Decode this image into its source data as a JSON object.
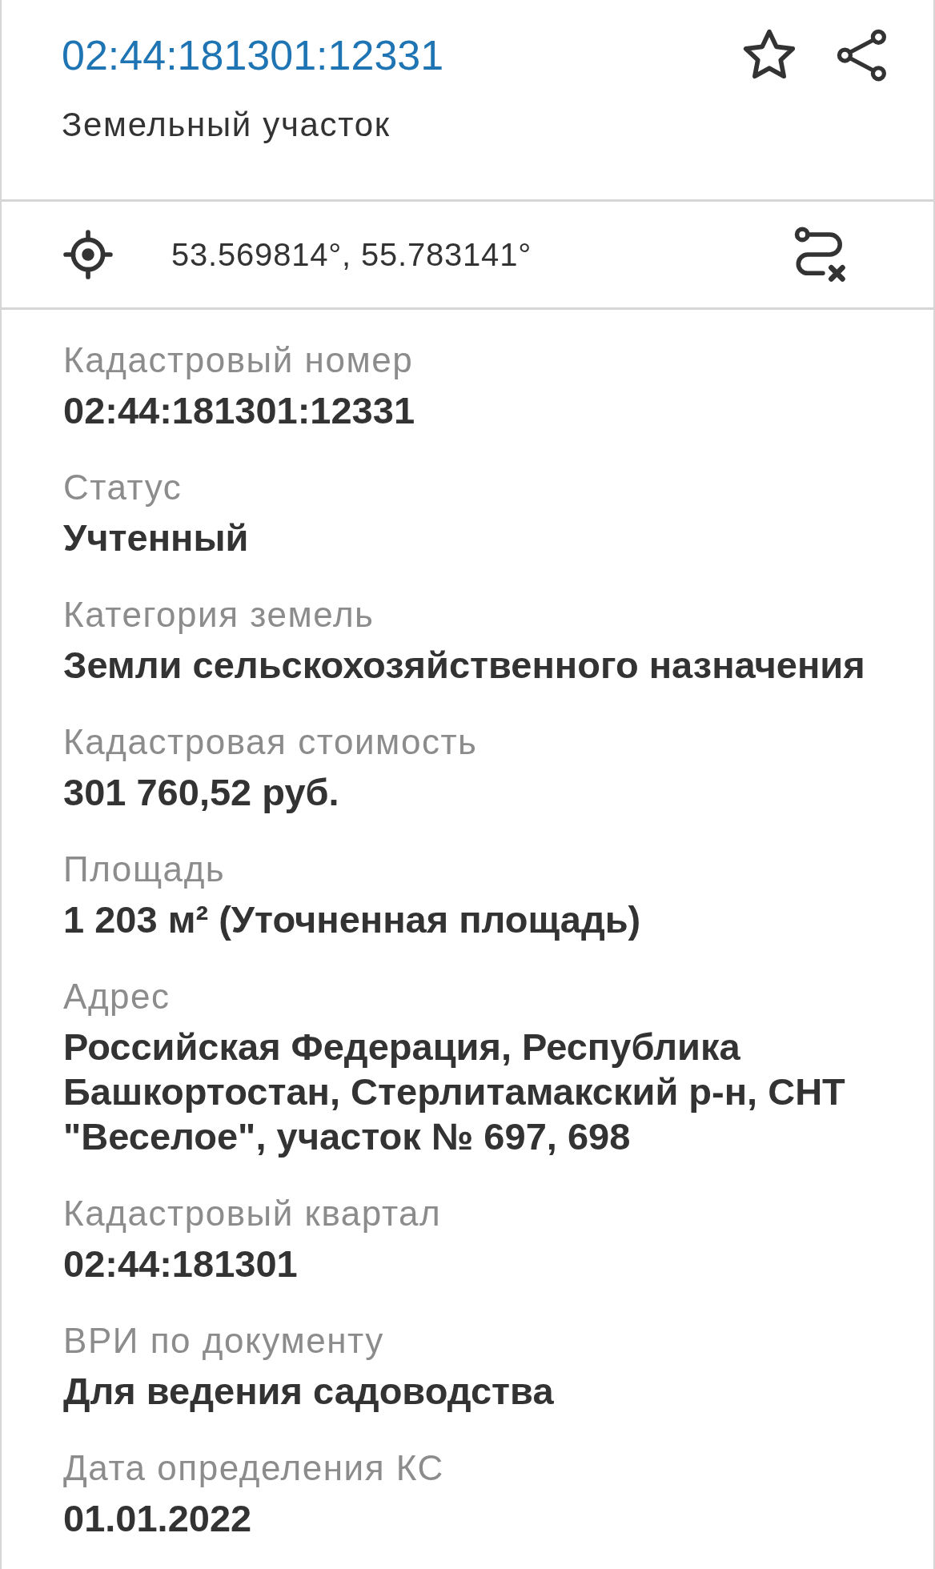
{
  "header": {
    "title": "02:44:181301:12331",
    "subtitle": "Земельный участок",
    "favorited": false
  },
  "location": {
    "coordinates": "53.569814°, 55.783141°"
  },
  "fields": [
    {
      "label": "Кадастровый номер",
      "value": "02:44:181301:12331"
    },
    {
      "label": "Статус",
      "value": "Учтенный"
    },
    {
      "label": "Категория земель",
      "value": "Земли сельскохозяйственного назначения"
    },
    {
      "label": "Кадастровая стоимость",
      "value": "301 760,52 руб."
    },
    {
      "label": "Площадь",
      "value": "1 203 м² (Уточненная площадь)"
    },
    {
      "label": "Адрес",
      "value": "Российская Федерация, Республика Башкортостан, Стерлитамакский р-н, СНТ \"Веселое\", участок № 697, 698"
    },
    {
      "label": "Кадастровый квартал",
      "value": "02:44:181301"
    },
    {
      "label": "ВРИ по документу",
      "value": "Для ведения садоводства"
    },
    {
      "label": "Дата определения КС",
      "value": "01.01.2022"
    }
  ]
}
